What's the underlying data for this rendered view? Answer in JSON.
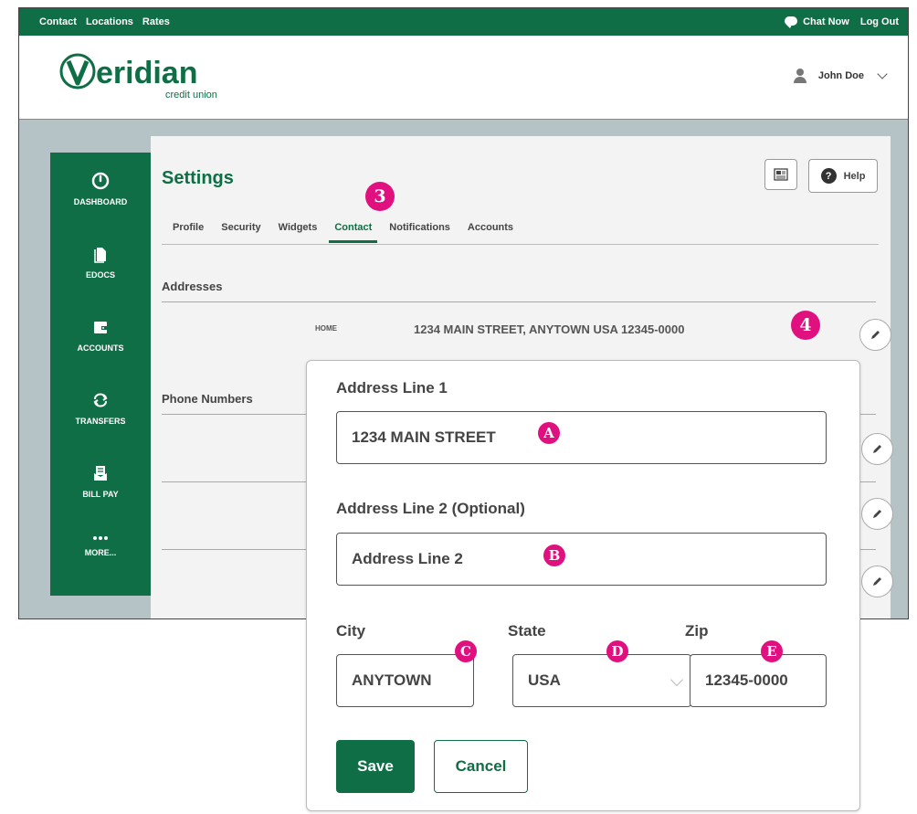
{
  "topbar": {
    "links": [
      "Contact",
      "Locations",
      "Rates"
    ],
    "chat_label": "Chat Now",
    "logout_label": "Log Out"
  },
  "header": {
    "logo_name": "Veridian",
    "logo_sub": "credit union",
    "user_name": "John Doe"
  },
  "sidenav": {
    "items": [
      {
        "label": "DASHBOARD",
        "icon": "dashboard-icon"
      },
      {
        "label": "EDOCS",
        "icon": "document-icon"
      },
      {
        "label": "ACCOUNTS",
        "icon": "wallet-icon"
      },
      {
        "label": "TRANSFERS",
        "icon": "transfer-icon"
      },
      {
        "label": "BILL PAY",
        "icon": "bill-pay-icon"
      },
      {
        "label": "MORE...",
        "icon": "more-icon"
      }
    ]
  },
  "settings": {
    "title": "Settings",
    "help_label": "Help",
    "tabs": [
      "Profile",
      "Security",
      "Widgets",
      "Contact",
      "Notifications",
      "Accounts"
    ],
    "active_tab": "Contact",
    "addresses_label": "Addresses",
    "address_type": "HOME",
    "address_value": "1234 MAIN STREET, ANYTOWN USA 12345-0000",
    "phone_label": "Phone Numbers"
  },
  "form": {
    "line1_label": "Address Line 1",
    "line1_value": "1234 MAIN STREET",
    "line2_label": "Address Line 2 (Optional)",
    "line2_value": "Address Line 2",
    "city_label": "City",
    "city_value": "ANYTOWN",
    "state_label": "State",
    "state_value": "USA",
    "zip_label": "Zip",
    "zip_value": "12345-0000",
    "save_label": "Save",
    "cancel_label": "Cancel"
  },
  "callouts": {
    "tab_marker": "3",
    "edit_marker": "4",
    "line1_marker": "A",
    "line2_marker": "B",
    "city_marker": "C",
    "state_marker": "D",
    "zip_marker": "E"
  },
  "colors": {
    "brand_green": "#0f6e46",
    "callout_pink": "#e0117f"
  }
}
